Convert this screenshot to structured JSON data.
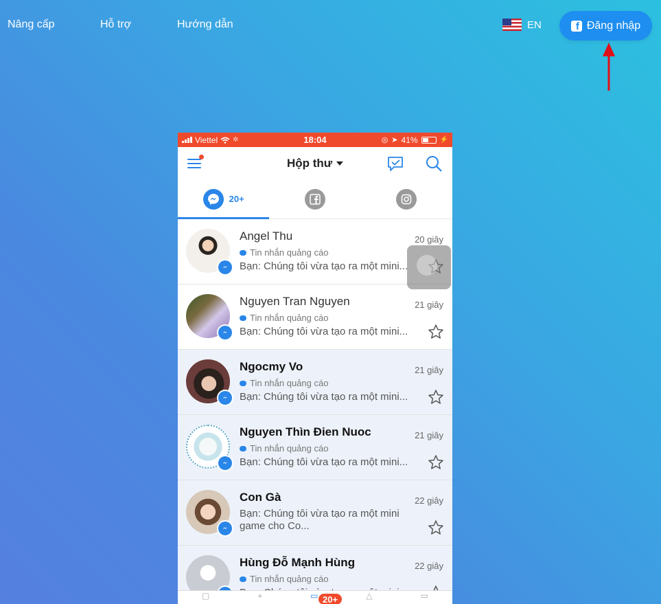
{
  "nav": {
    "upgrade": "Nâng cấp",
    "support": "Hỗ trợ",
    "guide": "Hướng dẫn",
    "language": "EN",
    "login": "Đăng nhập"
  },
  "phone": {
    "status": {
      "carrier": "Viettel",
      "time": "18:04",
      "battery": "41%"
    },
    "header": {
      "title": "Hộp thư"
    },
    "tabs": [
      {
        "icon": "messenger-icon",
        "count": "20+"
      },
      {
        "icon": "facebook-icon"
      },
      {
        "icon": "instagram-icon"
      }
    ],
    "conversations": [
      {
        "name": "Angel Thu",
        "tag": "Tin nhắn quảng cáo",
        "preview": "Bạn: Chúng tôi vừa tạo ra một mini...",
        "time": "20 giây"
      },
      {
        "name": "Nguyen Tran Nguyen",
        "tag": "Tin nhắn quảng cáo",
        "preview": "Bạn: Chúng tôi vừa tạo ra một mini...",
        "time": "21 giây"
      },
      {
        "name": "Ngocmy Vo",
        "tag": "Tin nhắn quảng cáo",
        "preview": "Bạn: Chúng tôi vừa tạo ra một mini...",
        "time": "21 giây"
      },
      {
        "name": "Nguyen Thìn Đien Nuoc",
        "tag": "Tin nhắn quảng cáo",
        "preview": "Bạn: Chúng tôi vừa tạo ra một mini...",
        "time": "21 giây"
      },
      {
        "name": "Con Gà",
        "preview": "Bạn: Chúng tôi vừa tạo ra một mini game cho Co...",
        "time": "22 giây"
      },
      {
        "name": "Hùng Đỗ Mạnh Hùng",
        "tag": "Tin nhắn quảng cáo",
        "preview": "Bạn: Chúng tôi vừa tạo ra một mini...",
        "time": "22 giây"
      }
    ],
    "bottom_badge": "20+"
  },
  "colors": {
    "accent": "#2a86e8",
    "status_bar": "#f04a2c",
    "login_button": "#1e8ef0",
    "arrow": "#e0101a"
  }
}
